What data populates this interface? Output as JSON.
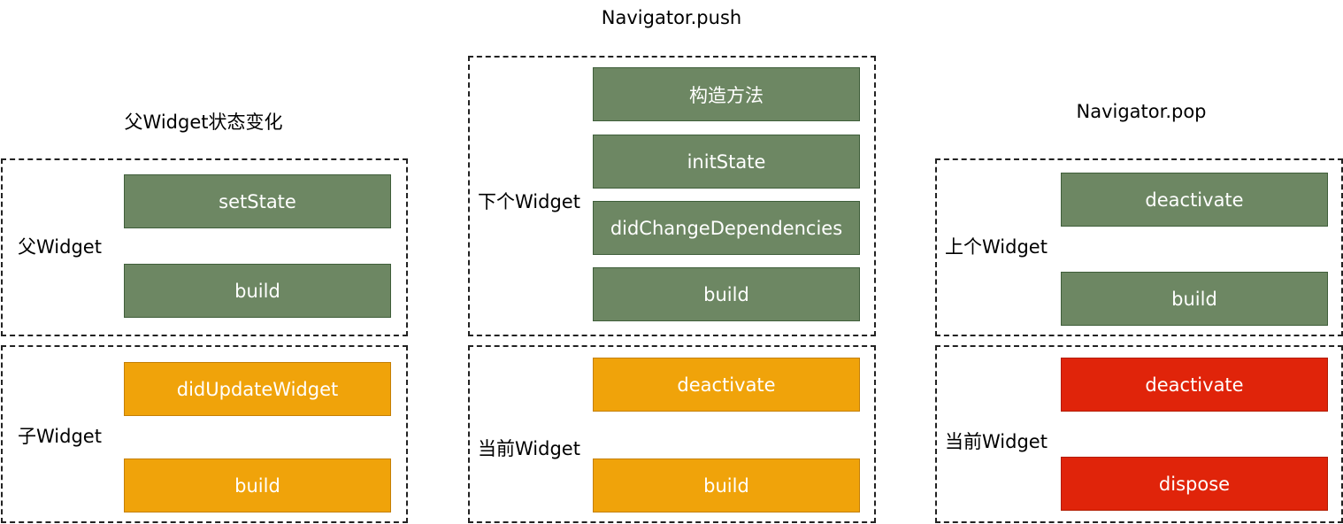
{
  "colors": {
    "green": "#6d8763",
    "green_border": "#3f5e3a",
    "orange": "#f0a30a",
    "orange_border": "#c47f06",
    "red": "#e0240a",
    "red_border": "#b21b00"
  },
  "columns": {
    "left": {
      "title": "父Widget状态变化",
      "top_group": {
        "label": "父Widget",
        "boxes": [
          "setState",
          "build"
        ]
      },
      "bottom_group": {
        "label": "子Widget",
        "boxes": [
          "didUpdateWidget",
          "build"
        ]
      }
    },
    "middle": {
      "title": "Navigator.push",
      "top_group": {
        "label": "下个Widget",
        "boxes": [
          "构造方法",
          "initState",
          "didChangeDependencies",
          "build"
        ]
      },
      "bottom_group": {
        "label": "当前Widget",
        "boxes": [
          "deactivate",
          "build"
        ]
      }
    },
    "right": {
      "title": "Navigator.pop",
      "top_group": {
        "label": "上个Widget",
        "boxes": [
          "deactivate",
          "build"
        ]
      },
      "bottom_group": {
        "label": "当前Widget",
        "boxes": [
          "deactivate",
          "dispose"
        ]
      }
    }
  }
}
